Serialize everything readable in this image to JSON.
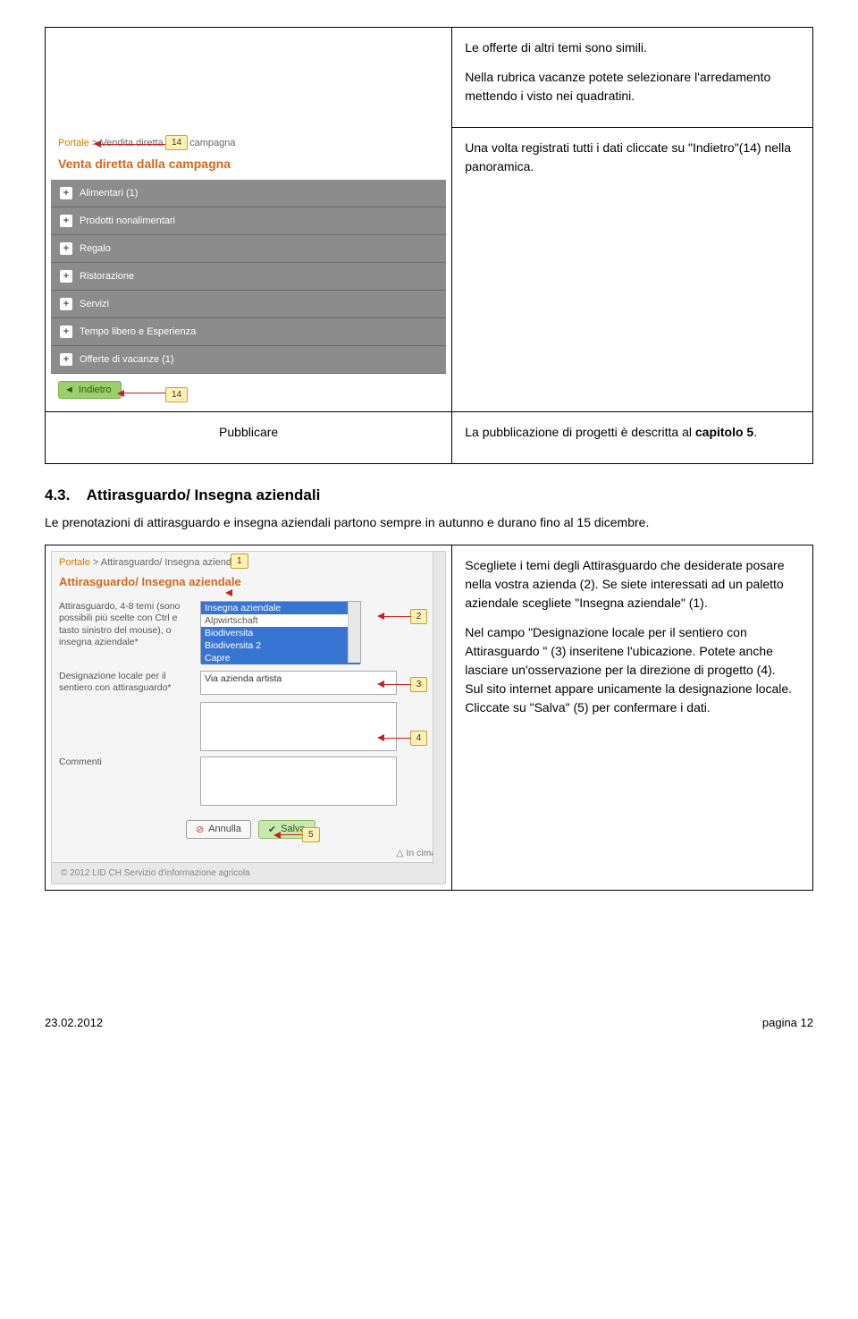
{
  "table1": {
    "row1_text1": "Le offerte di altri temi sono simili.",
    "row1_text2": "Nella rubrica vacanze potete selezionare l'arredamento mettendo i visto nei quadratini.",
    "row2_text": "Una volta registrati tutti i dati cliccate su \"Indietro\"(14) nella panoramica.",
    "mock1": {
      "breadcrumb_link": "Portale",
      "breadcrumb_rest": " > Vendita diretta dalla campagna",
      "title": "Venta diretta dalla campagna",
      "items": [
        "Alimentari (1)",
        "Prodotti nonalimentari",
        "Regalo",
        "Ristorazione",
        "Servizi",
        "Tempo libero e Esperienza",
        "Offerte di vacanze (1)"
      ],
      "back_label": "Indietro",
      "callout_top": "14",
      "callout_bottom": "14"
    },
    "row3_left": "Pubblicare",
    "row3_right_1": "La pubblicazione di progetti è descritta al ",
    "row3_right_2": "capitolo 5",
    "row3_right_3": "."
  },
  "section": {
    "num": "4.3.",
    "title": "Attirasguardo/ Insegna aziendali"
  },
  "intro": "Le prenotazioni di attirasguardo e insegna aziendali partono sempre in autunno e durano fino al 15 dicembre.",
  "table2": {
    "mock2": {
      "breadcrumb_link": "Portale",
      "breadcrumb_rest": " > Attirasguardo/ Insegna aziendale",
      "title": "Attirasguardo/ Insegna aziendale",
      "label1": "Attirasguardo, 4-8 temi (sono possibili più scelte con Ctrl e tasto sinistro del mouse), o insegna aziendale*",
      "options": [
        "Insegna aziendale",
        "Alpwirtschaft",
        "Biodiversita",
        "Biodiversita 2",
        "Capre"
      ],
      "label2": "Designazione locale per il sentiero con attirasguardo*",
      "input2_value": "Via azienda artista",
      "label3": "Commenti",
      "btn_cancel": "Annulla",
      "btn_save": "Salva",
      "in_cima": "In cima",
      "copyright": "© 2012 LID CH Servizio d'informazione agricola",
      "callouts": [
        "1",
        "2",
        "3",
        "4",
        "5"
      ]
    },
    "p1": "Scegliete i temi degli Attirasguardo che desiderate posare nella vostra azienda (2). Se siete interessati ad un paletto aziendale scegliete \"Insegna aziendale\" (1).",
    "p2_a": "Nel campo \"Designazione locale per il sentiero con Attirasguardo \" (3) inseritene l'ubicazione. Potete anche lasciare un'osservazione per la direzione di progetto (4).",
    "p2_b": "Sul sito internet appare unicamente la designazione locale.",
    "p2_c": "Cliccate su \"Salva\" (5) per confermare i dati."
  },
  "footer": {
    "date": "23.02.2012",
    "page": "pagina 12"
  }
}
